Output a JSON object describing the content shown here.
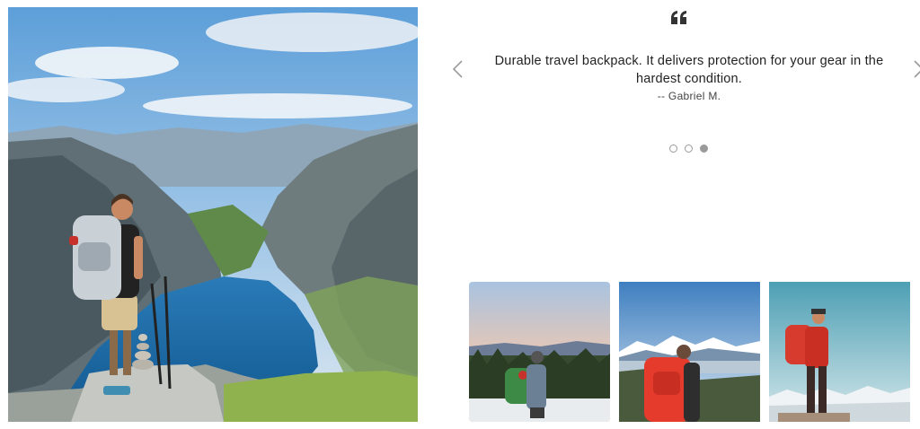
{
  "testimonial": {
    "quote": "Durable travel backpack. It delivers protection for your gear in the hardest condition.",
    "author": "-- Gabriel M.",
    "quote_icon": "double-quote-icon",
    "prev_icon": "chevron-left-icon",
    "next_icon": "chevron-right-icon",
    "slides": 3,
    "active_slide": 3
  },
  "hero_image": {
    "subject": "hiker-with-backpack-overlooking-fjord"
  },
  "thumbnails": [
    {
      "subject": "hiker-with-green-backpack-in-snow-at-sunset"
    },
    {
      "subject": "hiker-with-red-backpack-facing-mountains"
    },
    {
      "subject": "hiker-in-red-jacket-on-rock"
    }
  ],
  "colors": {
    "text": "#222222",
    "dot": "#9a9a9a",
    "lake": "#1f6ea8",
    "sky": "#7fb3e0"
  }
}
